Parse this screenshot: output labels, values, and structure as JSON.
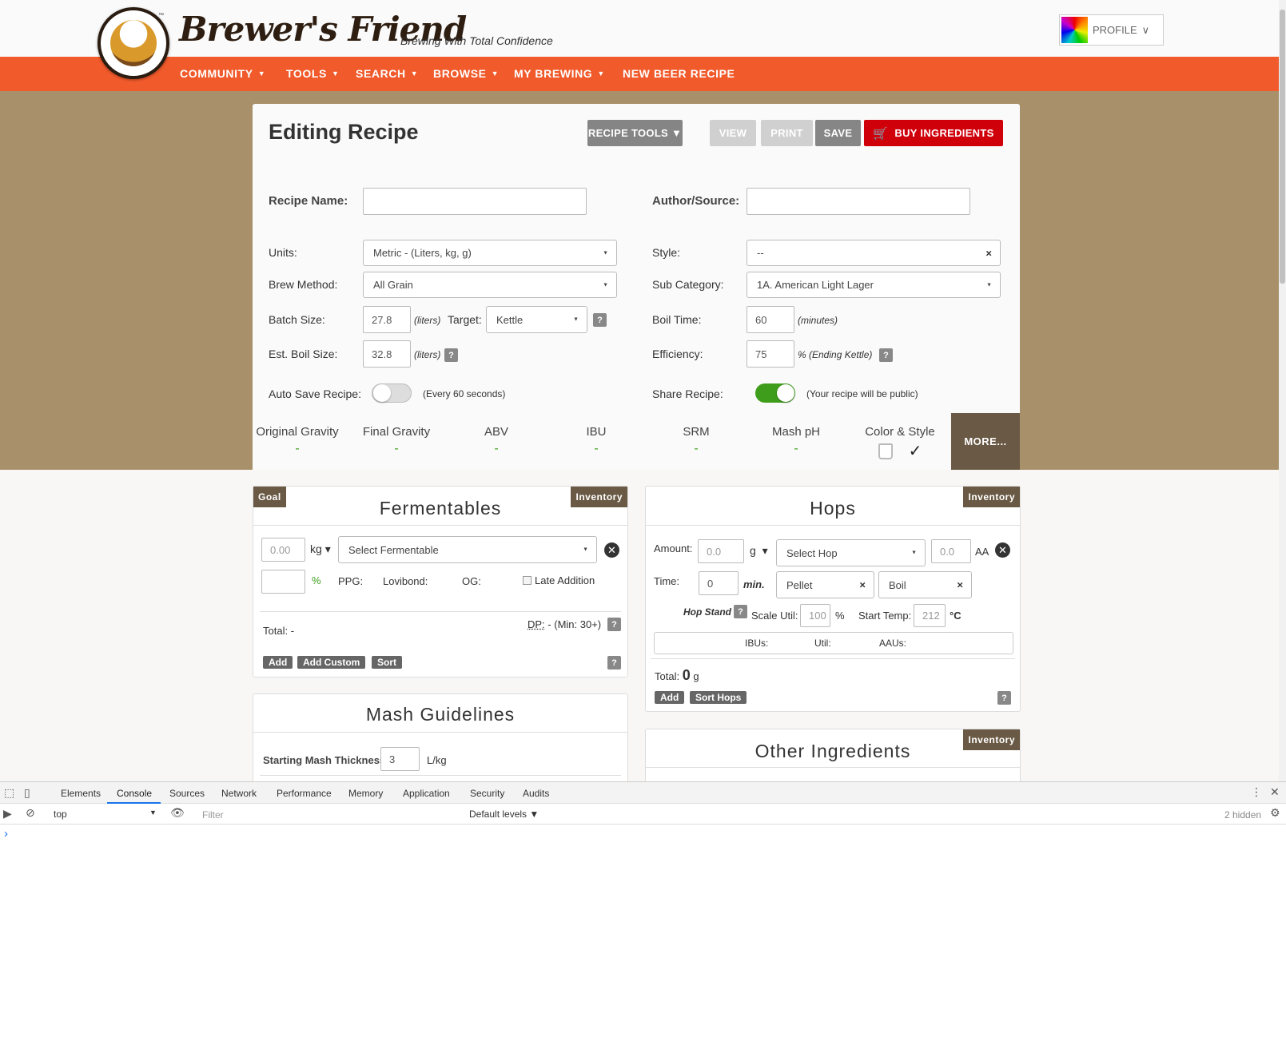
{
  "header": {
    "logo_text": "Brewer's Friend",
    "logo_tm": "™",
    "tagline": "Brewing With Total Confidence",
    "profile_label": "PROFILE",
    "profile_caret": "∨"
  },
  "nav": [
    {
      "label": "COMMUNITY",
      "caret": "▼"
    },
    {
      "label": "TOOLS",
      "caret": "▼"
    },
    {
      "label": "SEARCH",
      "caret": "▼"
    },
    {
      "label": "BROWSE",
      "caret": "▼"
    },
    {
      "label": "MY BREWING",
      "caret": "▼"
    },
    {
      "label": "NEW BEER RECIPE",
      "caret": ""
    }
  ],
  "editor": {
    "title": "Editing Recipe",
    "buttons": {
      "recipe_tools": "RECIPE TOOLS ▼",
      "view": "VIEW",
      "print": "PRINT",
      "save": "SAVE",
      "buy": "BUY INGREDIENTS"
    },
    "recipe_name_label": "Recipe Name:",
    "recipe_name_value": "",
    "author_label": "Author/Source:",
    "author_value": "",
    "units_label": "Units:",
    "units_value": "Metric - (Liters, kg, g)",
    "style_label": "Style:",
    "style_value": "--",
    "brew_method_label": "Brew Method:",
    "brew_method_value": "All Grain",
    "subcat_label": "Sub Category:",
    "subcat_value": "1A. American Light Lager",
    "batch_label": "Batch Size:",
    "batch_value": "27.8",
    "batch_unit": "(liters)",
    "target_label": "Target:",
    "target_value": "Kettle",
    "boil_time_label": "Boil Time:",
    "boil_time_value": "60",
    "boil_time_unit": "(minutes)",
    "boil_size_label": "Est. Boil Size:",
    "boil_size_value": "32.8",
    "boil_size_unit": "(liters)",
    "efficiency_label": "Efficiency:",
    "efficiency_value": "75",
    "efficiency_unit": "% (Ending Kettle)",
    "auto_save_label": "Auto Save Recipe:",
    "auto_save_on": false,
    "auto_save_note": "(Every 60 seconds)",
    "share_label": "Share Recipe:",
    "share_on": true,
    "share_note": "(Your recipe will be public)",
    "help": "?"
  },
  "stats": [
    {
      "label": "Original Gravity",
      "value": "-"
    },
    {
      "label": "Final Gravity",
      "value": "-"
    },
    {
      "label": "ABV",
      "value": "-"
    },
    {
      "label": "IBU",
      "value": "-"
    },
    {
      "label": "SRM",
      "value": "-"
    },
    {
      "label": "Mash pH",
      "value": "-"
    }
  ],
  "color_style_label": "Color & Style",
  "checkmark": "✓",
  "more_label": "MORE...",
  "fermentables": {
    "title": "Fermentables",
    "goal_tag": "Goal",
    "inventory_tag": "Inventory",
    "amount_value": "0.00",
    "amount_unit": "kg",
    "unit_caret": "▾",
    "select_placeholder": "Select Fermentable",
    "percent_value": "",
    "percent_sign": "%",
    "ppg_label": "PPG:",
    "lovibond_label": "Lovibond:",
    "og_label": "OG:",
    "late_addition_label": "Late Addition",
    "total_label": "Total:",
    "total_value": "-",
    "dp_label": "DP:",
    "dp_value": "- (Min: 30+)",
    "add_label": "Add",
    "add_custom_label": "Add Custom",
    "sort_label": "Sort"
  },
  "hops": {
    "title": "Hops",
    "inventory_tag": "Inventory",
    "amount_label": "Amount:",
    "amount_value": "0.0",
    "amount_unit": "g",
    "unit_caret": "▾",
    "select_placeholder": "Select Hop",
    "aa_value": "0.0",
    "aa_label": "AA",
    "time_label": "Time:",
    "time_value": "0",
    "time_unit": "min.",
    "form_value": "Pellet",
    "use_value": "Boil",
    "hop_stand_label": "Hop Stand",
    "scale_util_label": "Scale Util:",
    "scale_util_value": "100",
    "scale_util_unit": "%",
    "start_temp_label": "Start Temp:",
    "start_temp_value": "212",
    "start_temp_unit": "°C",
    "ibus_label": "IBUs:",
    "util_label": "Util:",
    "aaus_label": "AAUs:",
    "total_label": "Total:",
    "total_value": "0",
    "total_unit": "g",
    "add_label": "Add",
    "sort_label": "Sort Hops"
  },
  "mash": {
    "title": "Mash Guidelines",
    "thickness_label": "Starting Mash Thickness:",
    "thickness_value": "3",
    "thickness_unit": "L/kg"
  },
  "other": {
    "title": "Other Ingredients",
    "inventory_tag": "Inventory"
  },
  "devtools": {
    "tabs": [
      "Elements",
      "Console",
      "Sources",
      "Network",
      "Performance",
      "Memory",
      "Application",
      "Security",
      "Audits"
    ],
    "active_tab": "Console",
    "context": "top",
    "filter_placeholder": "Filter",
    "levels": "Default levels ▼",
    "hidden_count": "2 hidden",
    "prompt": "›"
  },
  "colors": {
    "nav_orange": "#f15a2b",
    "tan": "#a8916a",
    "buy_red": "#d0000b",
    "toggle_green": "#3e9d1a",
    "stat_green": "#3c9f1b",
    "tag_brown": "#6a5a45"
  }
}
